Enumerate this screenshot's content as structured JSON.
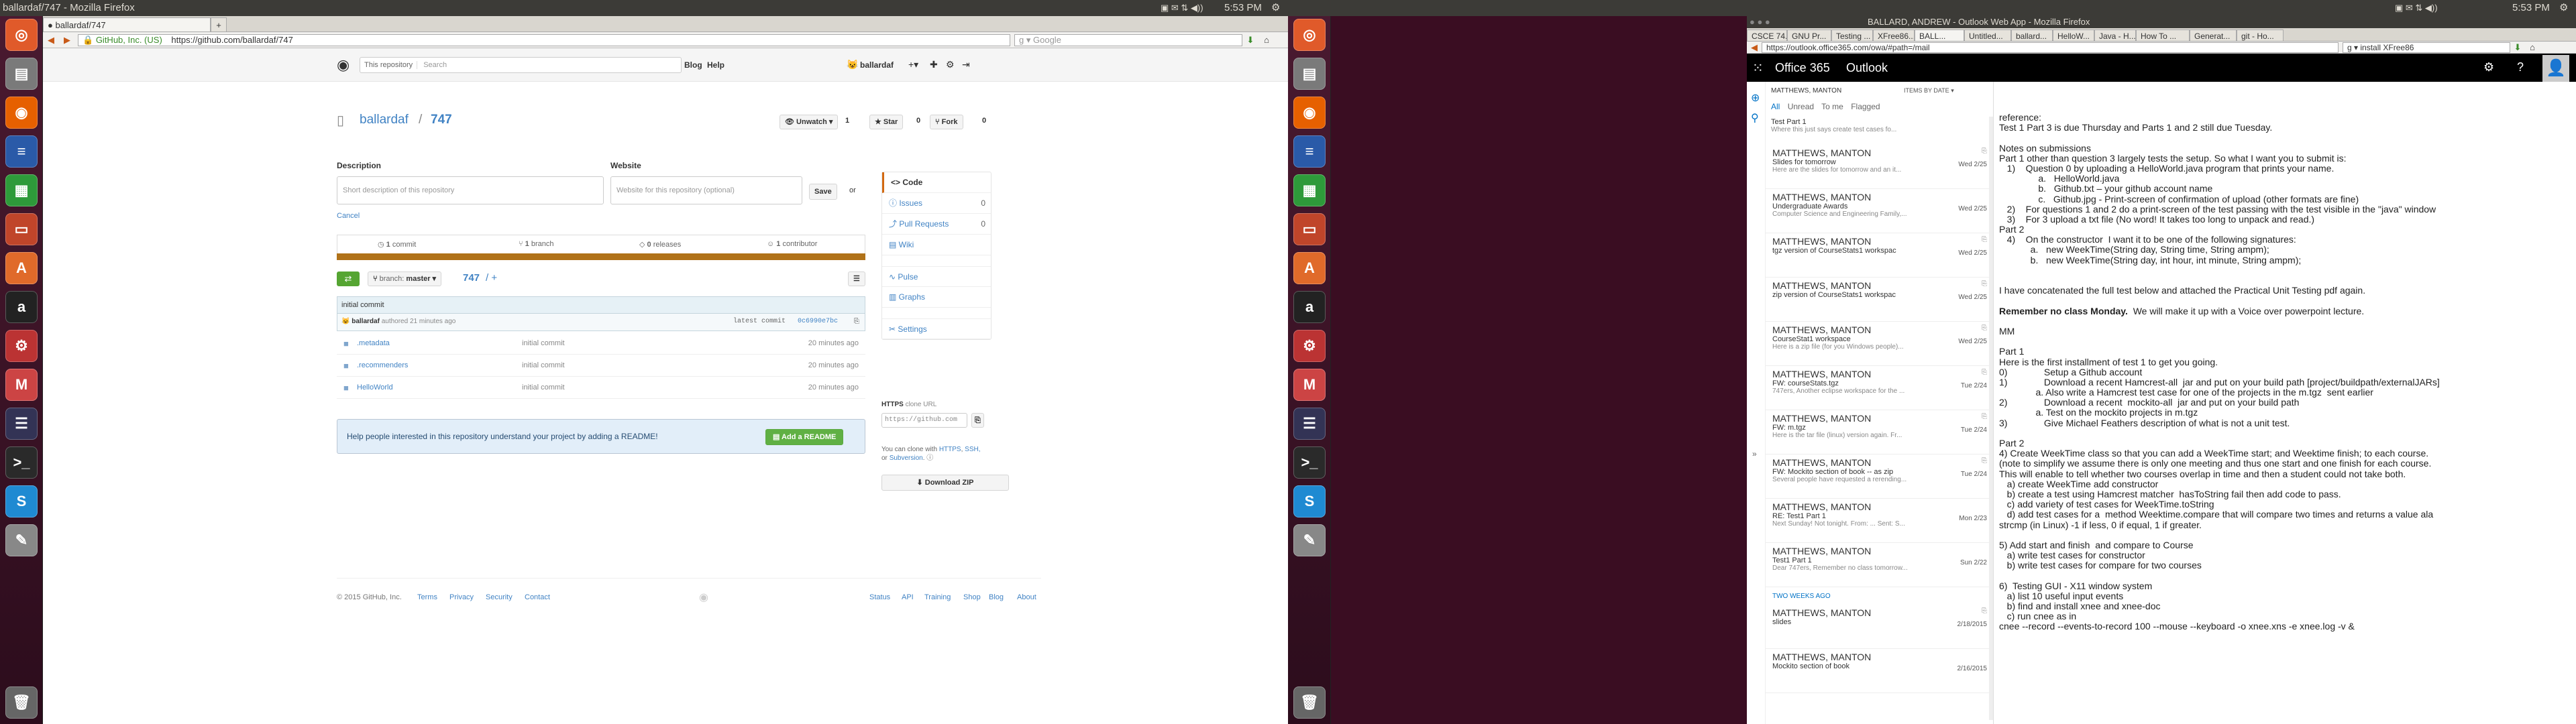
{
  "left_window": {
    "title_bar": "ballardaf/747 - Mozilla Firefox",
    "tab": "ballardaf/747",
    "identity": "GitHub, Inc. (US)",
    "url": "https://github.com/ballardaf/747",
    "search_placeholder": "Google"
  },
  "github": {
    "search_scope": "This repository",
    "search_placeholder": "Search",
    "nav_explore": "Blog",
    "nav_help": "Help",
    "username": "ballardaf",
    "repo_owner": "ballardaf",
    "repo_sep": "/",
    "repo_name": "747",
    "unwatch_label": "Unwatch",
    "unwatch_count": "1",
    "star_label": "Star",
    "star_count": "0",
    "fork_label": "Fork",
    "fork_count": "0",
    "description_label": "Description",
    "description_placeholder": "Short description of this repository",
    "website_label": "Website",
    "website_placeholder": "Website for this repository (optional)",
    "save_label": "Save",
    "or_label": "or",
    "cancel_label": "Cancel",
    "stats": [
      {
        "num": "1",
        "label": "commit"
      },
      {
        "num": "1",
        "label": "branch"
      },
      {
        "num": "0",
        "label": "releases"
      },
      {
        "num": "1",
        "label": "contributor"
      }
    ],
    "branch_prefix": "branch:",
    "branch_name": "master",
    "path_repo": "747",
    "path_plus": "/ +",
    "commit_message": "initial commit",
    "commit_author": "ballardaf",
    "commit_time": "authored 21 minutes ago",
    "latest_commit_label": "latest commit",
    "latest_commit_sha": "0c6990e7bc",
    "files": [
      {
        "name": ".metadata",
        "message": "initial commit",
        "age": "20 minutes ago"
      },
      {
        "name": ".recommenders",
        "message": "initial commit",
        "age": "20 minutes ago"
      },
      {
        "name": "HelloWorld",
        "message": "initial commit",
        "age": "20 minutes ago"
      }
    ],
    "readme_prompt": "Help people interested in this repository understand your project by adding a README!",
    "readme_button": "Add a README",
    "sidenav": [
      {
        "label": "Code",
        "count": ""
      },
      {
        "label": "Issues",
        "count": "0"
      },
      {
        "label": "Pull Requests",
        "count": "0"
      },
      {
        "label": "Wiki",
        "count": ""
      },
      {
        "label": "Pulse",
        "count": ""
      },
      {
        "label": "Graphs",
        "count": ""
      },
      {
        "label": "Settings",
        "count": ""
      }
    ],
    "clone_title": "HTTPS",
    "clone_sub": "clone URL",
    "clone_url": "https://github.com",
    "clone_note_1": "You can clone with",
    "clone_note_https": "HTTPS",
    "clone_note_ssh": "SSH,",
    "clone_note_or": "or",
    "clone_note_subversion": "Subversion",
    "download_zip": "Download ZIP",
    "footer_copyright": "© 2015 GitHub, Inc.",
    "footer_left": [
      "Terms",
      "Privacy",
      "Security",
      "Contact"
    ],
    "footer_right": [
      "Status",
      "API",
      "Training",
      "Shop",
      "Blog",
      "About"
    ]
  },
  "right_window": {
    "title_bar": "BALLARD, ANDREW - Outlook Web App - Mozilla Firefox",
    "tabs": [
      "CSCE 74...",
      "GNU Pr...",
      "Testing ...",
      "XFree86...",
      "BALL...",
      "Untitled...",
      "ballard...",
      "HelloW...",
      "Java - H...",
      "How To ...",
      "Generat...",
      "git - Ho..."
    ],
    "url": "https://outlook.office365.com/owa/#path=/mail",
    "search_value": "install XFree86"
  },
  "outlook": {
    "brand": "Office 365",
    "app": "Outlook",
    "list_header_from": "MATTHEWS, MANTON",
    "sort_label": "ITEMS BY DATE",
    "filters": [
      "All",
      "Unread",
      "To me",
      "Flagged"
    ],
    "top_partial_subject": "Test Part 1",
    "top_partial_preview": "Where this just says create test cases fo...",
    "messages": [
      {
        "from": "MATTHEWS, MANTON",
        "subject": "Slides for tomorrow",
        "preview": "Here are the slides for tomorrow and an it...",
        "date": "Wed 2/25"
      },
      {
        "from": "MATTHEWS, MANTON",
        "subject": "Undergraduate Awards",
        "preview": "Computer Science and Engineering Family,...",
        "date": "Wed 2/25"
      },
      {
        "from": "MATTHEWS, MANTON",
        "subject": "tgz version of CourseStats1 workspac",
        "preview": "",
        "date": "Wed 2/25"
      },
      {
        "from": "MATTHEWS, MANTON",
        "subject": "zip version of CourseStats1 workspac",
        "preview": "",
        "date": "Wed 2/25"
      },
      {
        "from": "MATTHEWS, MANTON",
        "subject": "CourseStat1 workspace",
        "preview": "Here is a zip file (for you Windows people)...",
        "date": "Wed 2/25"
      },
      {
        "from": "MATTHEWS, MANTON",
        "subject": "FW: courseStats.tgz",
        "preview": "747ers, Another eclipse workspace for the ...",
        "date": "Tue 2/24"
      },
      {
        "from": "MATTHEWS, MANTON",
        "subject": "FW: m.tgz",
        "preview": "Here is the tar file (linux) version again. Fr...",
        "date": "Tue 2/24"
      },
      {
        "from": "MATTHEWS, MANTON",
        "subject": "FW: Mockito section of book -- as zip",
        "preview": "Several people have requested a rerending...",
        "date": "Tue 2/24"
      },
      {
        "from": "MATTHEWS, MANTON",
        "subject": "RE: Test1 Part 1",
        "preview": "Next Sunday! Not tonight. From: ... Sent: S...",
        "date": "Mon 2/23"
      },
      {
        "from": "MATTHEWS, MANTON",
        "subject": "Test1 Part 1",
        "preview": "Dear 747ers, Remember no class tomorrow...",
        "date": "Sun 2/22"
      }
    ],
    "group_label": "TWO WEEKS AGO",
    "older": [
      {
        "from": "MATTHEWS, MANTON",
        "subject": "slides",
        "preview": "",
        "date": "2/18/2015"
      },
      {
        "from": "MATTHEWS, MANTON",
        "subject": "Mockito section of book",
        "preview": "",
        "date": "2/16/2015"
      }
    ],
    "body_lines": [
      "reference:",
      "Test 1 Part 3 is due Thursday and Parts 1 and 2 still due Tuesday.",
      "",
      "Notes on submissions",
      "Part 1 other than question 3 largely tests the setup. So what I want you to submit is:",
      "   1)    Question 0 by uploading a HelloWorld.java program that prints your name.",
      "               a.   HelloWorld.java",
      "               b.   Github.txt – your github account name",
      "               c.   Github.jpg - Print-screen of confirmation of upload (other formats are fine)",
      "   2)    For questions 1 and 2 do a print-screen of the test passing with the test visible in the \"java\" window",
      "   3)    For 3 upload a txt file (No word! It takes too long to unpack and read.)",
      "Part 2",
      "   4)    On the constructor  I want it to be one of the following signatures:",
      "            a.   new WeekTime(String day, String time, String ampm);",
      "            b.   new WeekTime(String day, int hour, int minute, String ampm);",
      "",
      "",
      "I have concatenated the full test below and attached the Practical Unit Testing pdf again.",
      "",
      "Remember no class Monday.  We will make it up with a Voice over powerpoint lecture.",
      "",
      "MM",
      "",
      "Part 1",
      "Here is the first installment of test 1 to get you going.",
      "0)              Setup a Github account",
      "1)              Download a recent Hamcrest-all  jar and put on your build path [project/buildpath/externalJARs]",
      "              a. Also write a Hamcrest test case for one of the projects in the m.tgz  sent earlier",
      "2)              Download a recent  mockito-all  jar and put on your build path",
      "              a. Test on the mockito projects in m.tgz",
      "3)              Give Michael Feathers description of what is not a unit test.",
      "",
      "Part 2",
      "4) Create WeekTime class so that you can add a WeekTime start; and Weektime finish; to each course.",
      "(note to simplify we assume there is only one meeting and thus one start and one finish for each course.",
      "This will enable to tell whether two courses overlap in time and then a student could not take both.",
      "   a) create WeekTime add constructor",
      "   b) create a test using Hamcrest matcher  hasToString fail then add code to pass.",
      "   c) add variety of test cases for WeekTime.toString",
      "   d) add test cases for a  method Weektime.compare that will compare two times and returns a value ala",
      "strcmp (in Linux) -1 if less, 0 if equal, 1 if greater.",
      "",
      "5) Add start and finish  and compare to Course",
      "   a) write test cases for constructor",
      "   b) write test cases for compare for two courses",
      "",
      "6)  Testing GUI - X11 window system",
      "   a) list 10 useful input events",
      "   b) find and install xnee and xnee-doc",
      "   c) run cnee as in",
      "cnee --record --events-to-record 100 --mouse --keyboard -o xnee.xns -e xnee.log -v &"
    ]
  },
  "system": {
    "time": "5:53 PM"
  }
}
